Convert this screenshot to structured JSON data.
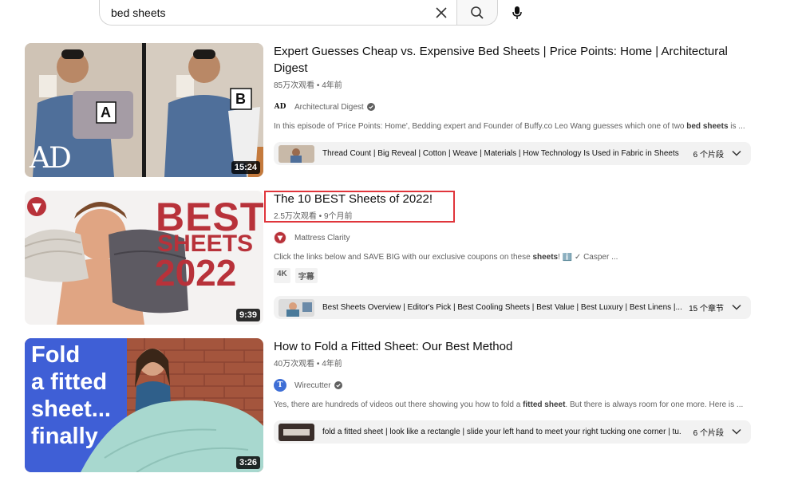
{
  "search": {
    "query": "bed sheets"
  },
  "results": [
    {
      "title": "Expert Guesses Cheap vs. Expensive Bed Sheets | Price Points: Home | Architectural Digest",
      "views": "85万次观看",
      "age": "4年前",
      "duration": "15:24",
      "channel": "Architectural Digest",
      "channel_avatar": "AD",
      "verified": true,
      "desc_before": "In this episode of 'Price Points: Home', Bedding expert and Founder of Buffy.co Leo Wang guesses which one of two ",
      "desc_bold": "bed sheets",
      "desc_after": " is ...",
      "chapters_text": "Thread Count | Big Reveal | Cotton | Weave | Materials | How Technology Is Used in Fabric in Sheets",
      "chapters_count": "6 个片段",
      "thumb": {
        "label_a": "A",
        "label_b": "B",
        "logo": "AD"
      }
    },
    {
      "title": "The 10 BEST Sheets of 2022!",
      "views": "2.5万次观看",
      "age": "9个月前",
      "duration": "9:39",
      "channel": "Mattress Clarity",
      "channel_avatar": "M",
      "verified": false,
      "desc_before": "Click the links below and SAVE BIG with our exclusive coupons on these ",
      "desc_bold": "sheets",
      "desc_after": "! ℹ️ ✓ Casper ...",
      "badges": [
        "4K",
        "字幕"
      ],
      "chapters_text": "Best Sheets Overview | Editor's Pick | Best Cooling Sheets | Best Value | Best Luxury | Best Linens |...",
      "chapters_count": "15 个章节",
      "thumb": {
        "line1": "BEST",
        "line2": "SHEETS",
        "line3": "2022"
      }
    },
    {
      "title": "How to Fold a Fitted Sheet: Our Best Method",
      "views": "40万次观看",
      "age": "4年前",
      "duration": "3:26",
      "channel": "Wirecutter",
      "channel_avatar": "T",
      "verified": true,
      "desc_before": "Yes, there are hundreds of videos out there showing you how to fold a ",
      "desc_bold": "fitted sheet",
      "desc_after": ". But there is always room for one more. Here is ...",
      "chapters_text": "fold a fitted sheet | look like a rectangle | slide your left hand to meet your right tucking one corner | tu...",
      "chapters_count": "6 个片段",
      "thumb": {
        "line1": "Fold",
        "line2": "a fitted",
        "line3": "sheet...",
        "line4": "finally"
      }
    }
  ],
  "colors": {
    "highlight": "#e0353b",
    "bestRed": "#b8323a",
    "foldBlue": "#3f5fd6"
  },
  "separator": " • "
}
